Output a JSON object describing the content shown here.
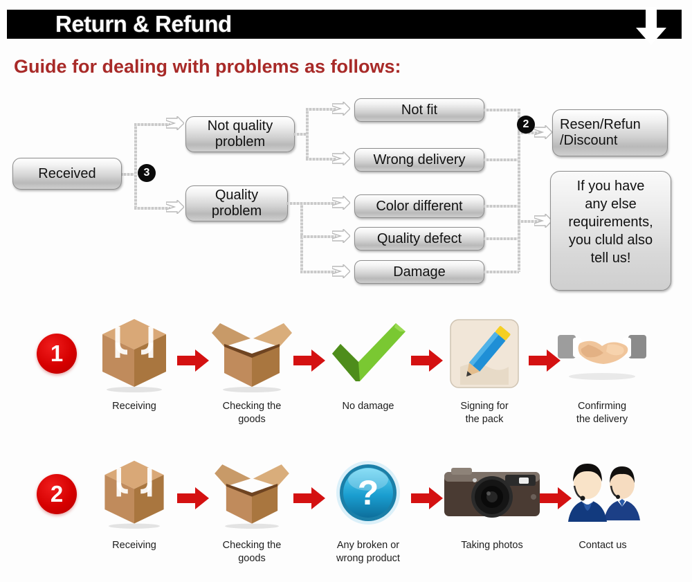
{
  "header": {
    "title": "Return & Refund",
    "arrow_icon": "down-arrow-icon",
    "bar_color": "#000000",
    "title_color": "#ffffff"
  },
  "guide": {
    "heading": "Guide for dealing with problems as follows:",
    "heading_color": "#a82a28"
  },
  "flowchart": {
    "nodes": {
      "received": "Received",
      "not_quality_problem": "Not quality\nproblem",
      "quality_problem": "Quality\nproblem",
      "not_fit": "Not fit",
      "wrong_delivery": "Wrong delivery",
      "color_different": "Color different",
      "quality_defect": "Quality defect",
      "damage": "Damage",
      "resolution": "Resen/Refun\n/Discount",
      "note_line1": "If you have",
      "note_line2": "any else",
      "note_line3": "requirements,",
      "note_line4": "you cluld also",
      "note_line5": "tell us!"
    },
    "labels": {
      "not_quality_l1": "Not quality",
      "not_quality_l2": "problem",
      "quality_l1": "Quality",
      "quality_l2": "problem",
      "resolution_l1": "Resen/Refun",
      "resolution_l2": "/Discount"
    },
    "badges": {
      "branch_badge": "3",
      "resolution_badge": "2"
    }
  },
  "process_rows": [
    {
      "number": "1",
      "steps": [
        {
          "label": "Receiving",
          "icon": "sealed-box-icon"
        },
        {
          "label": "Checking the\ngoods",
          "label_l1": "Checking the",
          "label_l2": "goods",
          "icon": "open-box-icon"
        },
        {
          "label": "No damage",
          "icon": "green-check-icon"
        },
        {
          "label": "Signing for\nthe pack",
          "label_l1": "Signing for",
          "label_l2": "the pack",
          "icon": "pencil-signing-icon"
        },
        {
          "label": "Confirming\nthe delivery",
          "label_l1": "Confirming",
          "label_l2": "the delivery",
          "icon": "handshake-icon"
        }
      ]
    },
    {
      "number": "2",
      "steps": [
        {
          "label": "Receiving",
          "icon": "sealed-box-icon"
        },
        {
          "label": "Checking the\ngoods",
          "label_l1": "Checking the",
          "label_l2": "goods",
          "icon": "open-box-icon"
        },
        {
          "label": "Any broken or\nwrong product",
          "label_l1": "Any broken or",
          "label_l2": "wrong product",
          "icon": "blue-question-icon"
        },
        {
          "label": "Taking photos",
          "icon": "camera-icon"
        },
        {
          "label": "Contact us",
          "icon": "support-agents-icon"
        }
      ]
    }
  ],
  "colors": {
    "red_arrow": "#d41111",
    "red_circle": "#d60000",
    "box_border": "#8d8d8d",
    "connector": "#cfcfcf"
  }
}
